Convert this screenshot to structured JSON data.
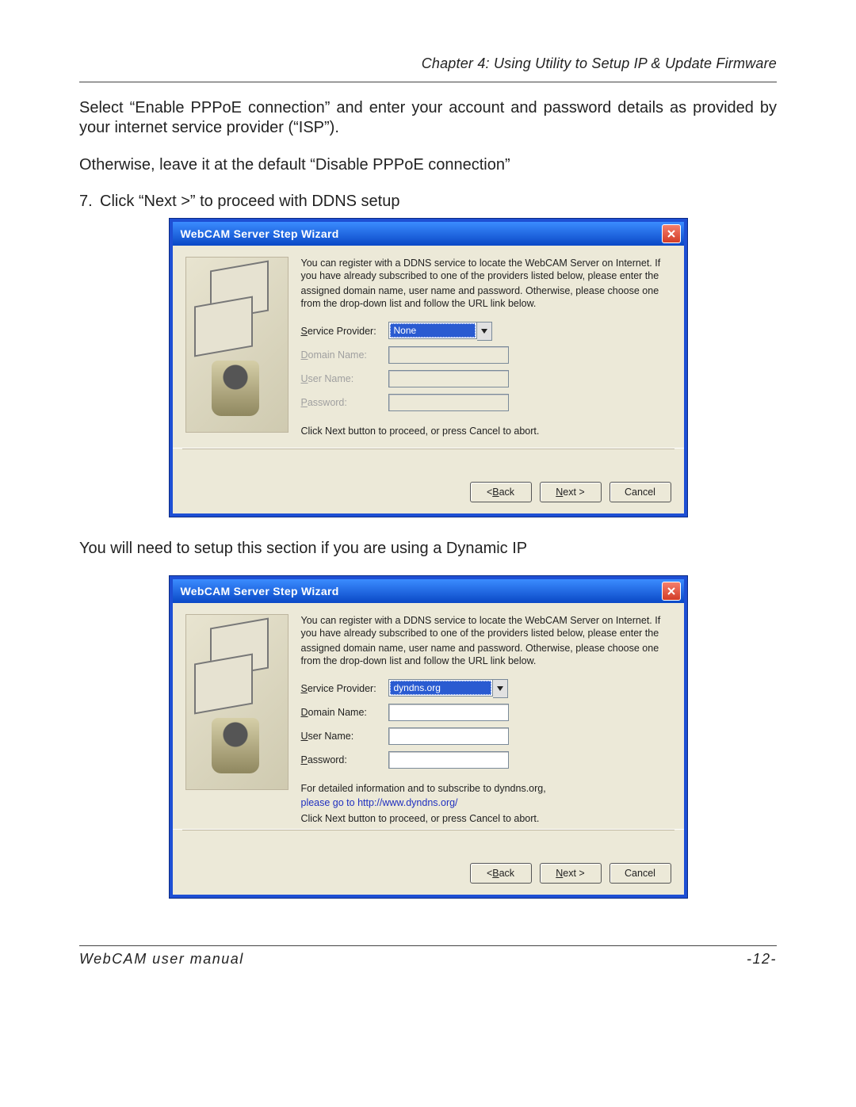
{
  "header": {
    "chapter": "Chapter 4: Using Utility to Setup IP & Update Firmware"
  },
  "para1": "Select “Enable PPPoE connection” and enter your account and password details as provided by your internet service provider (“ISP”).",
  "para2": "Otherwise, leave it at the default “Disable PPPoE connection”",
  "step7": {
    "num": "7.",
    "text": "Click “Next >” to proceed with DDNS setup"
  },
  "dlg_common": {
    "title": "WebCAM Server Step Wizard",
    "intro1": "You can register with a DDNS service to locate the WebCAM Server on Internet. If you have already subscribed to one of the providers listed below, please enter the",
    "intro2": "assigned domain name, user name and password.  Otherwise, please choose one from the drop-down list and follow the URL link below.",
    "labels": {
      "service": "ervice Provider:",
      "domain": "omain Name:",
      "user": "ser Name:",
      "pass": "assword:"
    },
    "proceed": "Click Next button to proceed, or press Cancel to abort.",
    "buttons": {
      "back": "ack",
      "next": "ext >",
      "cancel": "Cancel"
    }
  },
  "dlg1": {
    "provider": "None"
  },
  "mid_para": "You will need to setup this section if you are using a Dynamic IP",
  "dlg2": {
    "provider": "dyndns.org",
    "detail": "For detailed information and to subscribe to dyndns.org,",
    "link": "please go to http://www.dyndns.org/"
  },
  "footer": {
    "left": "WebCAM user manual",
    "right": "-12-"
  }
}
